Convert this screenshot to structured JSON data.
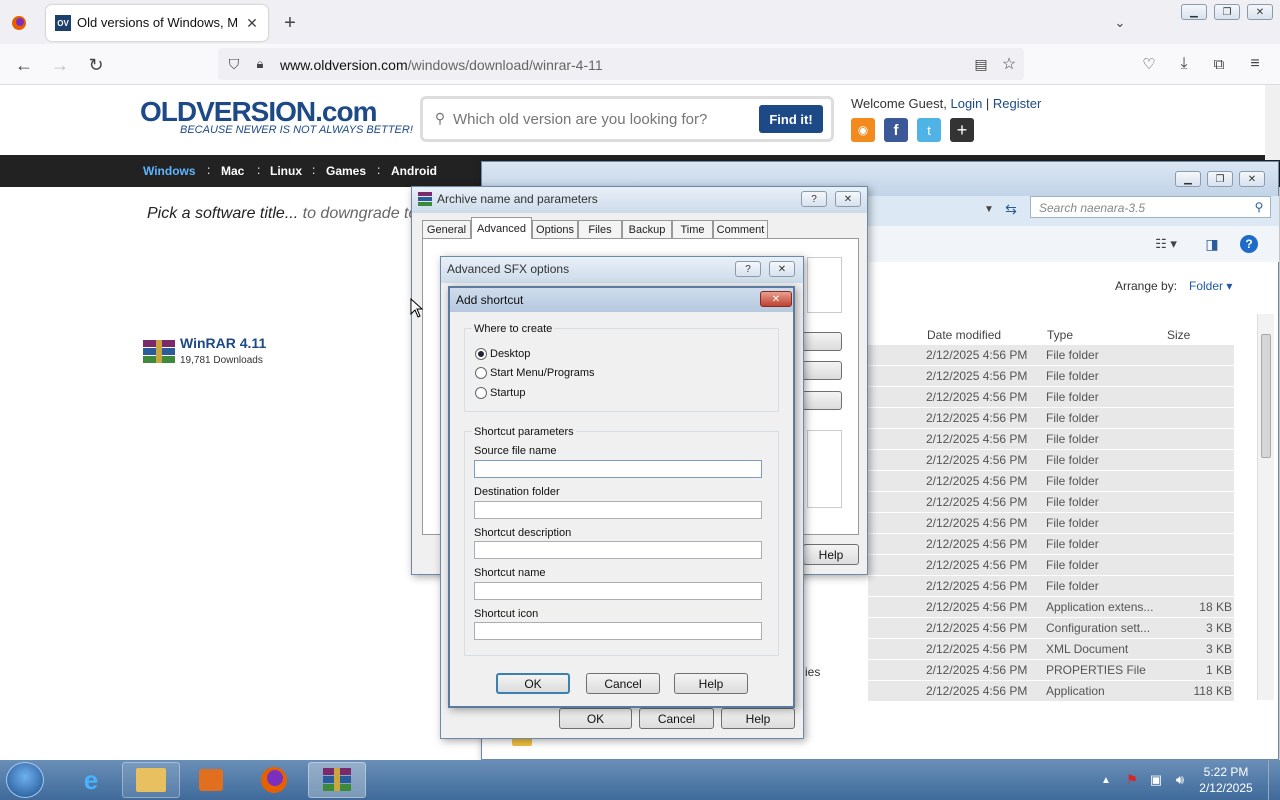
{
  "browser": {
    "tab_title": "Old versions of Windows, Mac",
    "url_domain": "www.oldversion.com",
    "url_path": "/windows/download/winrar-4-11"
  },
  "site": {
    "logo": "OLDVERSION.com",
    "tagline": "BECAUSE NEWER IS NOT ALWAYS BETTER!",
    "search_placeholder": "Which old version are you looking for?",
    "search_button": "Find it!",
    "welcome": "Welcome Guest,",
    "login": "Login",
    "register": "Register",
    "nav": [
      "Windows",
      "Mac",
      "Linux",
      "Games",
      "Android"
    ],
    "pick_text": "Pick a software title...",
    "pick_text2": "to downgrade to",
    "app_name": "WinRAR 4.11",
    "downloads": "19,781 Downloads"
  },
  "explorer": {
    "search_placeholder": "Search naenara-3.5",
    "arrange_label": "Arrange by:",
    "arrange_value": "Folder",
    "columns": [
      "Date modified",
      "Type",
      "Size"
    ],
    "partial_name": "ies",
    "rows": [
      {
        "date": "2/12/2025 4:56 PM",
        "type": "File folder",
        "size": ""
      },
      {
        "date": "2/12/2025 4:56 PM",
        "type": "File folder",
        "size": ""
      },
      {
        "date": "2/12/2025 4:56 PM",
        "type": "File folder",
        "size": ""
      },
      {
        "date": "2/12/2025 4:56 PM",
        "type": "File folder",
        "size": ""
      },
      {
        "date": "2/12/2025 4:56 PM",
        "type": "File folder",
        "size": ""
      },
      {
        "date": "2/12/2025 4:56 PM",
        "type": "File folder",
        "size": ""
      },
      {
        "date": "2/12/2025 4:56 PM",
        "type": "File folder",
        "size": ""
      },
      {
        "date": "2/12/2025 4:56 PM",
        "type": "File folder",
        "size": ""
      },
      {
        "date": "2/12/2025 4:56 PM",
        "type": "File folder",
        "size": ""
      },
      {
        "date": "2/12/2025 4:56 PM",
        "type": "File folder",
        "size": ""
      },
      {
        "date": "2/12/2025 4:56 PM",
        "type": "File folder",
        "size": ""
      },
      {
        "date": "2/12/2025 4:56 PM",
        "type": "File folder",
        "size": ""
      },
      {
        "date": "2/12/2025 4:56 PM",
        "type": "Application extens...",
        "size": "18 KB"
      },
      {
        "date": "2/12/2025 4:56 PM",
        "type": "Configuration sett...",
        "size": "3 KB"
      },
      {
        "date": "2/12/2025 4:56 PM",
        "type": "XML Document",
        "size": "3 KB"
      },
      {
        "date": "2/12/2025 4:56 PM",
        "type": "PROPERTIES File",
        "size": "1 KB"
      },
      {
        "date": "2/12/2025 4:56 PM",
        "type": "Application",
        "size": "118 KB"
      }
    ]
  },
  "archive_dialog": {
    "title": "Archive name and parameters",
    "tabs": [
      "General",
      "Advanced",
      "Options",
      "Files",
      "Backup",
      "Time",
      "Comment"
    ],
    "help": "Help"
  },
  "sfx_dialog": {
    "title": "Advanced SFX options",
    "ok": "OK",
    "cancel": "Cancel",
    "help": "Help"
  },
  "shortcut_dialog": {
    "title": "Add shortcut",
    "where_group": "Where to create",
    "options": [
      "Desktop",
      "Start Menu/Programs",
      "Startup"
    ],
    "params_group": "Shortcut parameters",
    "fields": [
      "Source file name",
      "Destination folder",
      "Shortcut description",
      "Shortcut name",
      "Shortcut icon"
    ],
    "ok": "OK",
    "cancel": "Cancel",
    "help": "Help"
  },
  "taskbar": {
    "time": "5:22 PM",
    "date": "2/12/2025"
  }
}
